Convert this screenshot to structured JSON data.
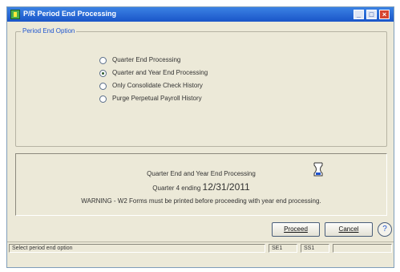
{
  "window": {
    "title": "P/R Period End Processing"
  },
  "group": {
    "legend": "Period End Option",
    "options": [
      {
        "label": "Quarter End Processing",
        "selected": false
      },
      {
        "label": "Quarter and Year End Processing",
        "selected": true
      },
      {
        "label": "Only Consolidate Check History",
        "selected": false
      },
      {
        "label": "Purge Perpetual Payroll History",
        "selected": false
      }
    ]
  },
  "info": {
    "mode": "Quarter End and Year End Processing",
    "period": "Quarter 4 ending",
    "date": "12/31/2011",
    "warning": "WARNING - W2 Forms must be printed before proceeding with year end processing."
  },
  "buttons": {
    "proceed": "Proceed",
    "cancel": "Cancel",
    "help": "?"
  },
  "status": {
    "message": "Select period end option",
    "company": "SE1",
    "user": "SS1"
  },
  "colors": {
    "accent": "#1f55d0",
    "titlebar": "#1a55c8"
  }
}
